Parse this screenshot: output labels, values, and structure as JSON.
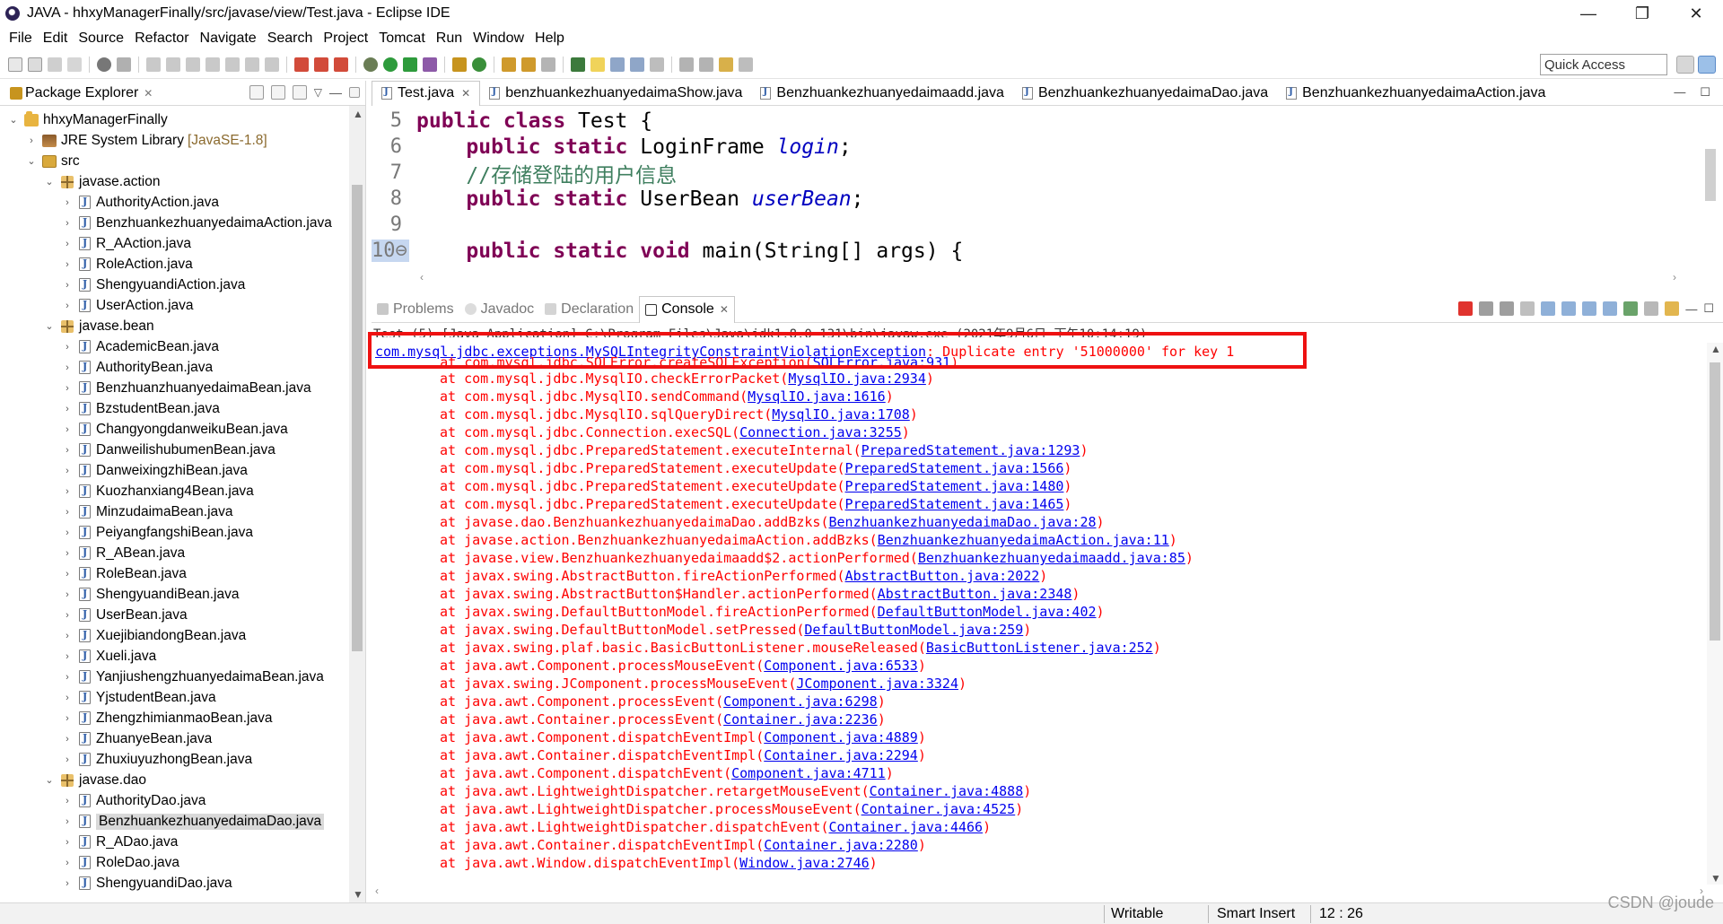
{
  "window": {
    "title": "JAVA - hhxyManagerFinally/src/javase/view/Test.java - Eclipse IDE",
    "controls": [
      "—",
      "❐",
      "✕"
    ]
  },
  "menu": [
    "File",
    "Edit",
    "Source",
    "Refactor",
    "Navigate",
    "Search",
    "Project",
    "Tomcat",
    "Run",
    "Window",
    "Help"
  ],
  "toolbar": {
    "quick_access": "Quick Access"
  },
  "package_explorer": {
    "title": "Package Explorer",
    "tree": [
      {
        "label": "hhxyManagerFinally",
        "type": "project",
        "level": 0,
        "twisty": "⌄"
      },
      {
        "label": "JRE System Library",
        "extra": "[JavaSE-1.8]",
        "type": "library",
        "level": 1,
        "twisty": "›"
      },
      {
        "label": "src",
        "type": "src",
        "level": 1,
        "twisty": "⌄"
      },
      {
        "label": "javase.action",
        "type": "package",
        "level": 2,
        "twisty": "⌄"
      },
      {
        "label": "AuthorityAction.java",
        "type": "java",
        "level": 3,
        "twisty": "›"
      },
      {
        "label": "BenzhuankezhuanyedaimaAction.java",
        "type": "java",
        "level": 3,
        "twisty": "›"
      },
      {
        "label": "R_AAction.java",
        "type": "java",
        "level": 3,
        "twisty": "›"
      },
      {
        "label": "RoleAction.java",
        "type": "java",
        "level": 3,
        "twisty": "›"
      },
      {
        "label": "ShengyuandiAction.java",
        "type": "java",
        "level": 3,
        "twisty": "›"
      },
      {
        "label": "UserAction.java",
        "type": "java",
        "level": 3,
        "twisty": "›"
      },
      {
        "label": "javase.bean",
        "type": "package",
        "level": 2,
        "twisty": "⌄"
      },
      {
        "label": "AcademicBean.java",
        "type": "java",
        "level": 3,
        "twisty": "›"
      },
      {
        "label": "AuthorityBean.java",
        "type": "java",
        "level": 3,
        "twisty": "›"
      },
      {
        "label": "BenzhuanzhuanyedaimaBean.java",
        "type": "java",
        "level": 3,
        "twisty": "›"
      },
      {
        "label": "BzstudentBean.java",
        "type": "java",
        "level": 3,
        "twisty": "›"
      },
      {
        "label": "ChangyongdanweikuBean.java",
        "type": "java",
        "level": 3,
        "twisty": "›"
      },
      {
        "label": "DanweilishubumenBean.java",
        "type": "java",
        "level": 3,
        "twisty": "›"
      },
      {
        "label": "DanweixingzhiBean.java",
        "type": "java",
        "level": 3,
        "twisty": "›"
      },
      {
        "label": "Kuozhanxiang4Bean.java",
        "type": "java",
        "level": 3,
        "twisty": "›"
      },
      {
        "label": "MinzudaimaBean.java",
        "type": "java",
        "level": 3,
        "twisty": "›"
      },
      {
        "label": "PeiyangfangshiBean.java",
        "type": "java",
        "level": 3,
        "twisty": "›"
      },
      {
        "label": "R_ABean.java",
        "type": "java",
        "level": 3,
        "twisty": "›"
      },
      {
        "label": "RoleBean.java",
        "type": "java",
        "level": 3,
        "twisty": "›"
      },
      {
        "label": "ShengyuandiBean.java",
        "type": "java",
        "level": 3,
        "twisty": "›"
      },
      {
        "label": "UserBean.java",
        "type": "java",
        "level": 3,
        "twisty": "›"
      },
      {
        "label": "XuejibiandongBean.java",
        "type": "java",
        "level": 3,
        "twisty": "›"
      },
      {
        "label": "Xueli.java",
        "type": "java",
        "level": 3,
        "twisty": "›"
      },
      {
        "label": "YanjiushengzhuanyedaimaBean.java",
        "type": "java",
        "level": 3,
        "twisty": "›"
      },
      {
        "label": "YjstudentBean.java",
        "type": "java",
        "level": 3,
        "twisty": "›"
      },
      {
        "label": "ZhengzhimianmaoBean.java",
        "type": "java",
        "level": 3,
        "twisty": "›"
      },
      {
        "label": "ZhuanyeBean.java",
        "type": "java",
        "level": 3,
        "twisty": "›"
      },
      {
        "label": "ZhuxiuyuzhongBean.java",
        "type": "java",
        "level": 3,
        "twisty": "›"
      },
      {
        "label": "javase.dao",
        "type": "package",
        "level": 2,
        "twisty": "⌄"
      },
      {
        "label": "AuthorityDao.java",
        "type": "java",
        "level": 3,
        "twisty": "›"
      },
      {
        "label": "BenzhuankezhuanyedaimaDao.java",
        "type": "java",
        "level": 3,
        "twisty": "›",
        "selected": true
      },
      {
        "label": "R_ADao.java",
        "type": "java",
        "level": 3,
        "twisty": "›"
      },
      {
        "label": "RoleDao.java",
        "type": "java",
        "level": 3,
        "twisty": "›"
      },
      {
        "label": "ShengyuandiDao.java",
        "type": "java",
        "level": 3,
        "twisty": "›"
      }
    ]
  },
  "editor": {
    "tabs": [
      {
        "label": "Test.java",
        "active": true
      },
      {
        "label": "benzhuankezhuanyedaimaShow.java"
      },
      {
        "label": "Benzhuankezhuanyedaimaadd.java"
      },
      {
        "label": "BenzhuankezhuanyedaimaDao.java"
      },
      {
        "label": "BenzhuankezhuanyedaimaAction.java"
      }
    ],
    "lines": [
      {
        "num": "5",
        "tokens": [
          {
            "t": "public class ",
            "c": "kw"
          },
          {
            "t": "Test {",
            "c": ""
          }
        ]
      },
      {
        "num": "6",
        "tokens": [
          {
            "t": "    public static ",
            "c": "kw"
          },
          {
            "t": "LoginFrame ",
            "c": ""
          },
          {
            "t": "login",
            "c": "fld"
          },
          {
            "t": ";",
            "c": ""
          }
        ]
      },
      {
        "num": "7",
        "tokens": [
          {
            "t": "    //存储登陆的用户信息",
            "c": "cmt"
          }
        ]
      },
      {
        "num": "8",
        "tokens": [
          {
            "t": "    public static ",
            "c": "kw"
          },
          {
            "t": "UserBean ",
            "c": ""
          },
          {
            "t": "userBean",
            "c": "fld"
          },
          {
            "t": ";",
            "c": ""
          }
        ]
      },
      {
        "num": "9",
        "tokens": [
          {
            "t": "",
            "c": ""
          }
        ]
      },
      {
        "num": "10⊖",
        "tokens": [
          {
            "t": "    public static void ",
            "c": "kw"
          },
          {
            "t": "main(String[] args) {",
            "c": ""
          }
        ]
      }
    ]
  },
  "console": {
    "tabs": [
      "Problems",
      "Javadoc",
      "Declaration",
      "Console"
    ],
    "active_tab": "Console",
    "header": "Test (5) [Java Application] C:\\Program Files\\Java\\jdk1.8.0_131\\bin\\javaw.exe (2021年9月6日 下午10:14:19)",
    "exception": {
      "link": "com.mysql.jdbc.exceptions.MySQLIntegrityConstraintViolationException",
      "message": ": Duplicate entry '51000000' for key 1"
    },
    "partial_line": {
      "prefix": "\tat com.mysql.jdbc.SQLError.createSQLException(",
      "link": "SQLError.java:931",
      "suffix": ")"
    },
    "frames": [
      {
        "m": "com.mysql.jdbc.MysqlIO.checkErrorPacket",
        "f": "MysqlIO.java:2934"
      },
      {
        "m": "com.mysql.jdbc.MysqlIO.sendCommand",
        "f": "MysqlIO.java:1616"
      },
      {
        "m": "com.mysql.jdbc.MysqlIO.sqlQueryDirect",
        "f": "MysqlIO.java:1708"
      },
      {
        "m": "com.mysql.jdbc.Connection.execSQL",
        "f": "Connection.java:3255"
      },
      {
        "m": "com.mysql.jdbc.PreparedStatement.executeInternal",
        "f": "PreparedStatement.java:1293"
      },
      {
        "m": "com.mysql.jdbc.PreparedStatement.executeUpdate",
        "f": "PreparedStatement.java:1566"
      },
      {
        "m": "com.mysql.jdbc.PreparedStatement.executeUpdate",
        "f": "PreparedStatement.java:1480"
      },
      {
        "m": "com.mysql.jdbc.PreparedStatement.executeUpdate",
        "f": "PreparedStatement.java:1465"
      },
      {
        "m": "javase.dao.BenzhuankezhuanyedaimaDao.addBzks",
        "f": "BenzhuankezhuanyedaimaDao.java:28"
      },
      {
        "m": "javase.action.BenzhuankezhuanyedaimaAction.addBzks",
        "f": "BenzhuankezhuanyedaimaAction.java:11"
      },
      {
        "m": "javase.view.Benzhuankezhuanyedaimaadd$2.actionPerformed",
        "f": "Benzhuankezhuanyedaimaadd.java:85"
      },
      {
        "m": "javax.swing.AbstractButton.fireActionPerformed",
        "f": "AbstractButton.java:2022"
      },
      {
        "m": "javax.swing.AbstractButton$Handler.actionPerformed",
        "f": "AbstractButton.java:2348"
      },
      {
        "m": "javax.swing.DefaultButtonModel.fireActionPerformed",
        "f": "DefaultButtonModel.java:402"
      },
      {
        "m": "javax.swing.DefaultButtonModel.setPressed",
        "f": "DefaultButtonModel.java:259"
      },
      {
        "m": "javax.swing.plaf.basic.BasicButtonListener.mouseReleased",
        "f": "BasicButtonListener.java:252"
      },
      {
        "m": "java.awt.Component.processMouseEvent",
        "f": "Component.java:6533"
      },
      {
        "m": "javax.swing.JComponent.processMouseEvent",
        "f": "JComponent.java:3324"
      },
      {
        "m": "java.awt.Component.processEvent",
        "f": "Component.java:6298"
      },
      {
        "m": "java.awt.Container.processEvent",
        "f": "Container.java:2236"
      },
      {
        "m": "java.awt.Component.dispatchEventImpl",
        "f": "Component.java:4889"
      },
      {
        "m": "java.awt.Container.dispatchEventImpl",
        "f": "Container.java:2294"
      },
      {
        "m": "java.awt.Component.dispatchEvent",
        "f": "Component.java:4711"
      },
      {
        "m": "java.awt.LightweightDispatcher.retargetMouseEvent",
        "f": "Container.java:4888"
      },
      {
        "m": "java.awt.LightweightDispatcher.processMouseEvent",
        "f": "Container.java:4525"
      },
      {
        "m": "java.awt.LightweightDispatcher.dispatchEvent",
        "f": "Container.java:4466"
      },
      {
        "m": "java.awt.Container.dispatchEventImpl",
        "f": "Container.java:2280"
      },
      {
        "m": "java.awt.Window.dispatchEventImpl",
        "f": "Window.java:2746"
      }
    ]
  },
  "status": {
    "writable": "Writable",
    "insert_mode": "Smart Insert",
    "position": "12 : 26"
  },
  "watermark": "CSDN @joude",
  "colors": {
    "error_text": "#ff0000",
    "link": "#0000ee",
    "highlight_box": "#ee1111",
    "keyword": "#7f0055",
    "field": "#0000c0",
    "comment": "#3f7f5f"
  }
}
